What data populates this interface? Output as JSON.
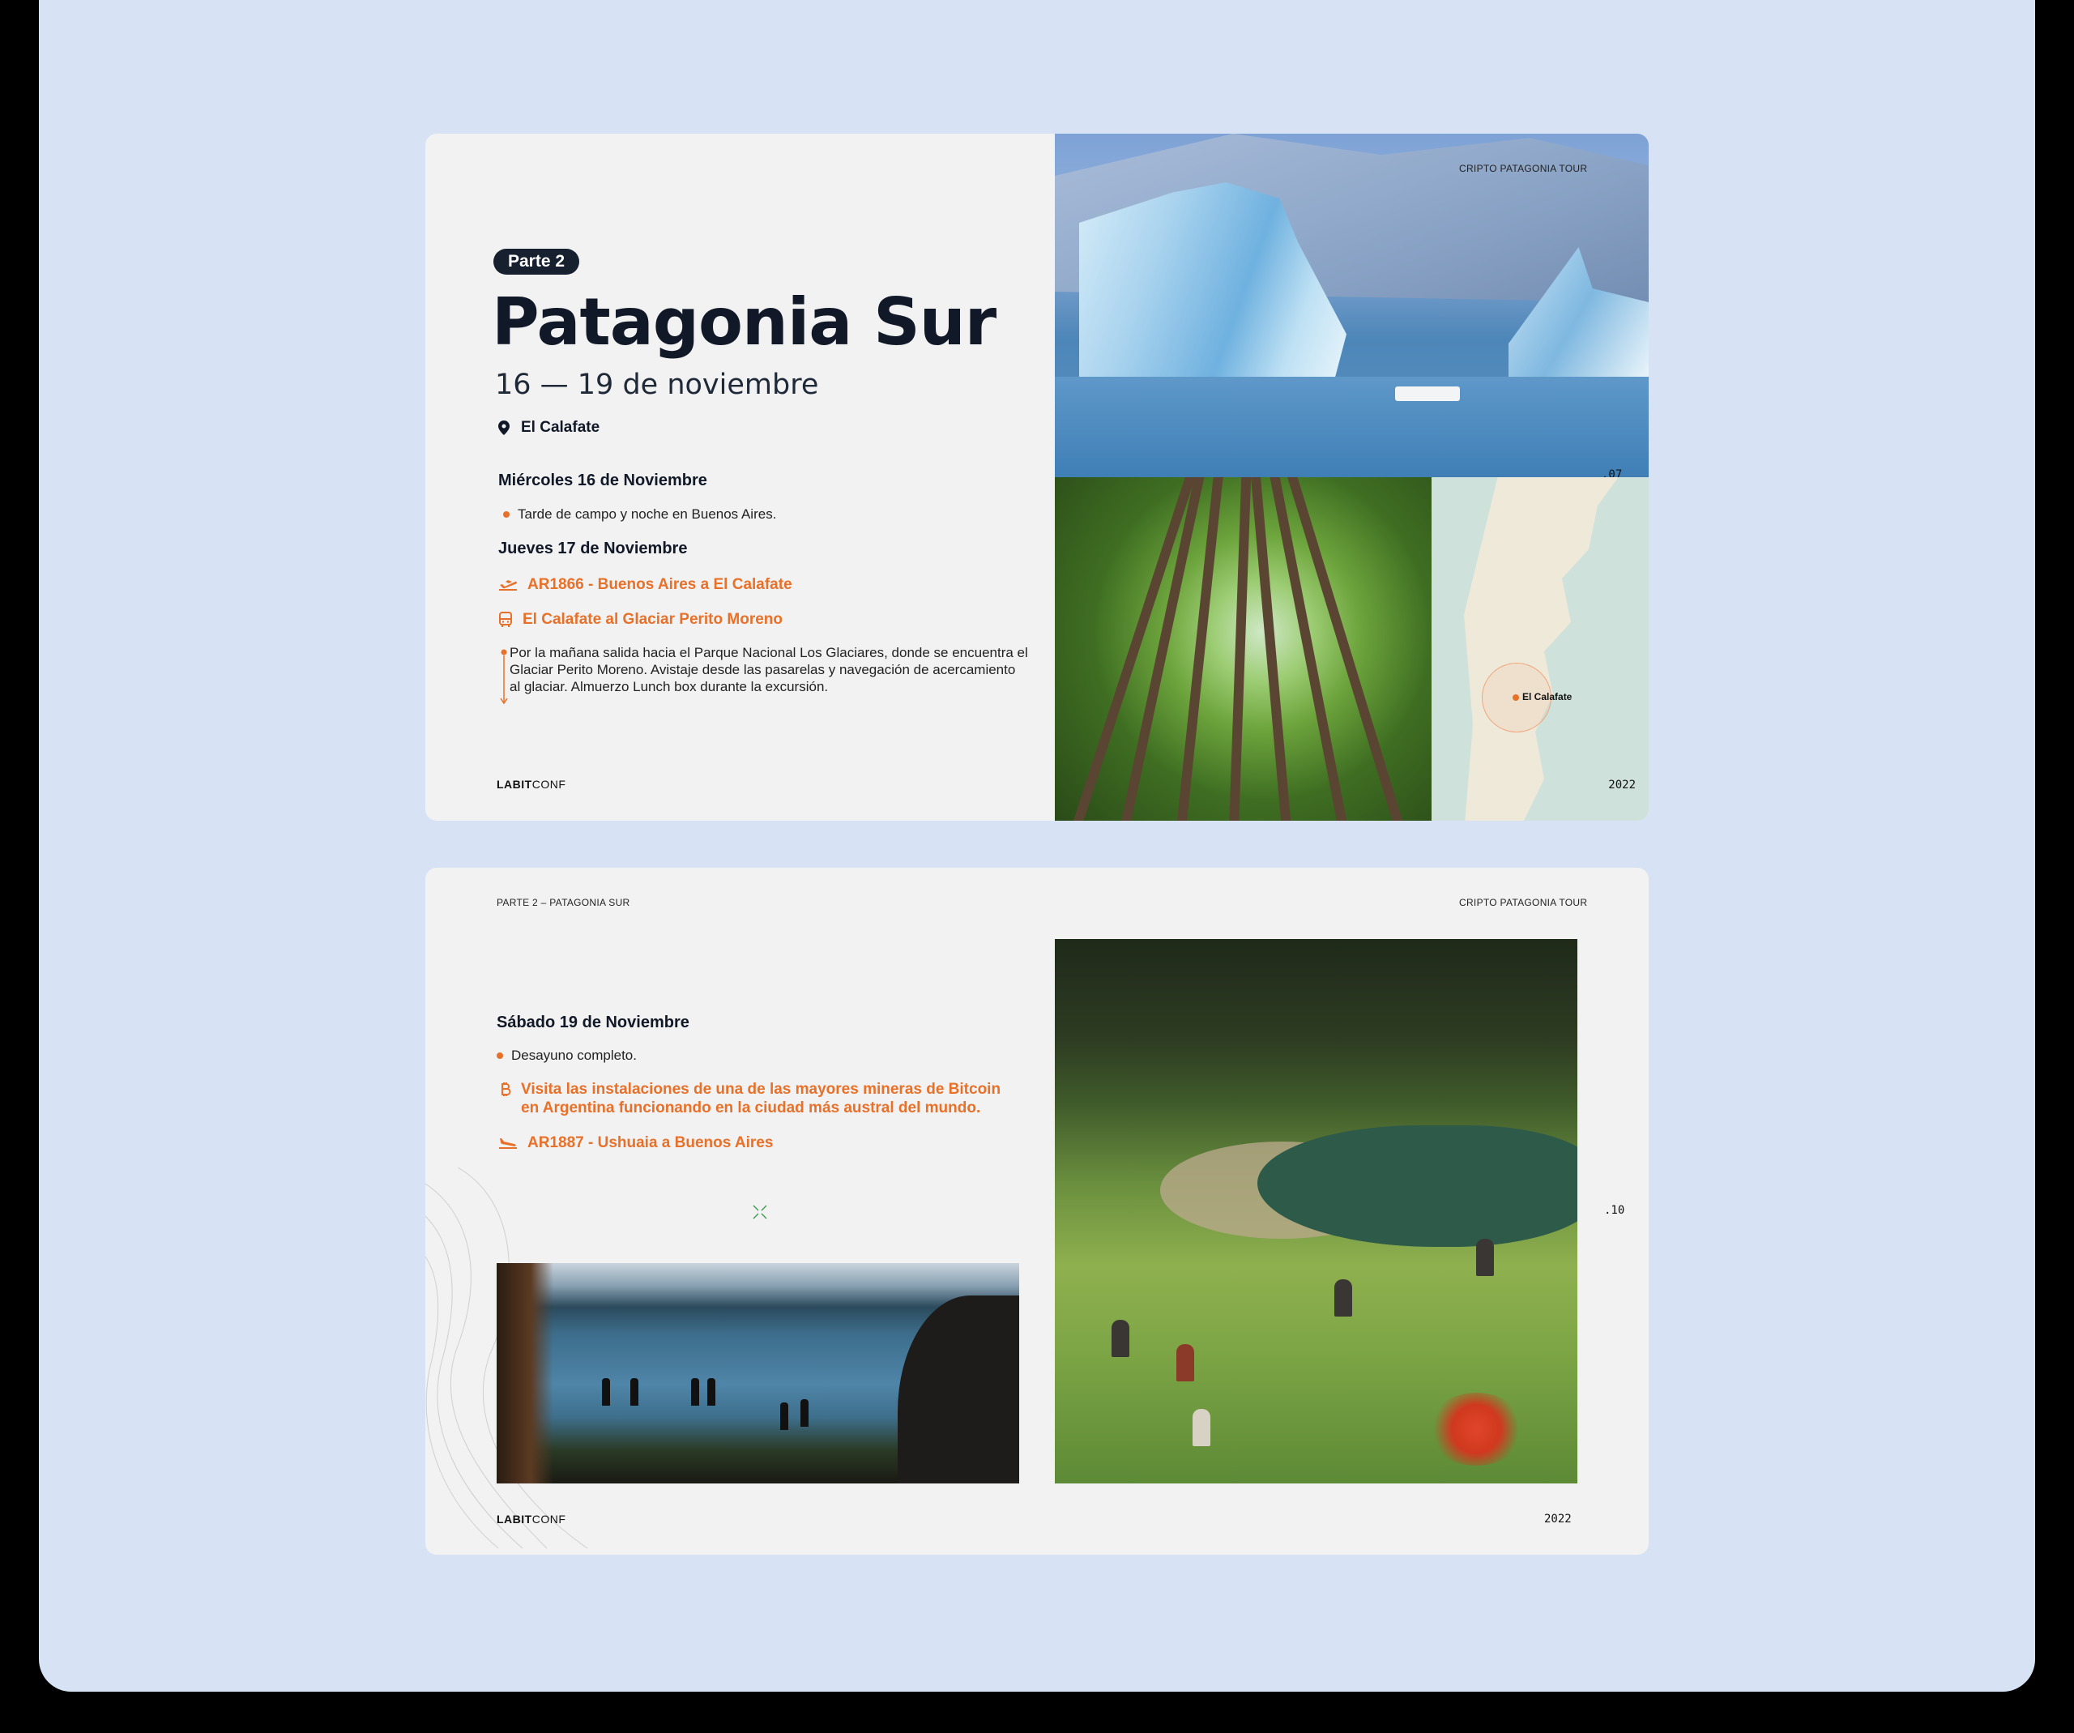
{
  "slide1": {
    "badge": "Parte 2",
    "title": "Patagonia Sur",
    "dates": "16 — 19 de noviembre",
    "location": "El Calafate",
    "day1": {
      "heading": "Miércoles 16 de Noviembre",
      "bullet": "Tarde de campo y noche en Buenos Aires."
    },
    "day2": {
      "heading": "Jueves 17 de Noviembre",
      "flight": "AR1866 - Buenos Aires a El Calafate",
      "bus": "El Calafate al Glaciar Perito Moreno",
      "description": "Por la mañana salida hacia el Parque Nacional Los Glaciares, donde se encuentra el Glaciar Perito Moreno. Avistaje desde las pasarelas y navegación de acercamiento al glaciar. Almuerzo Lunch box durante la excursión."
    },
    "logo_bold": "LABIT",
    "logo_light": "CONF",
    "photo_caption": "CRIPTO PATAGONIA TOUR",
    "page_number": ".07",
    "map_label": "El Calafate",
    "year": "2022"
  },
  "slide2": {
    "header_left": "PARTE 2 – PATAGONIA SUR",
    "header_right": "CRIPTO PATAGONIA TOUR",
    "day": {
      "heading": "Sábado 19 de Noviembre",
      "bullet": "Desayuno completo.",
      "bitcoin_line1": "Visita las instalaciones de una de las mayores mineras de Bitcoin",
      "bitcoin_line2": "en Argentina funcionando en la ciudad más austral del mundo.",
      "flight": "AR1887 - Ushuaia a Buenos Aires"
    },
    "page_number": ".10",
    "logo_bold": "LABIT",
    "logo_light": "CONF",
    "year": "2022"
  },
  "colors": {
    "accent": "#e8712a",
    "background": "#d7e3f4",
    "slide": "#f2f2f2",
    "ink": "#111827"
  }
}
